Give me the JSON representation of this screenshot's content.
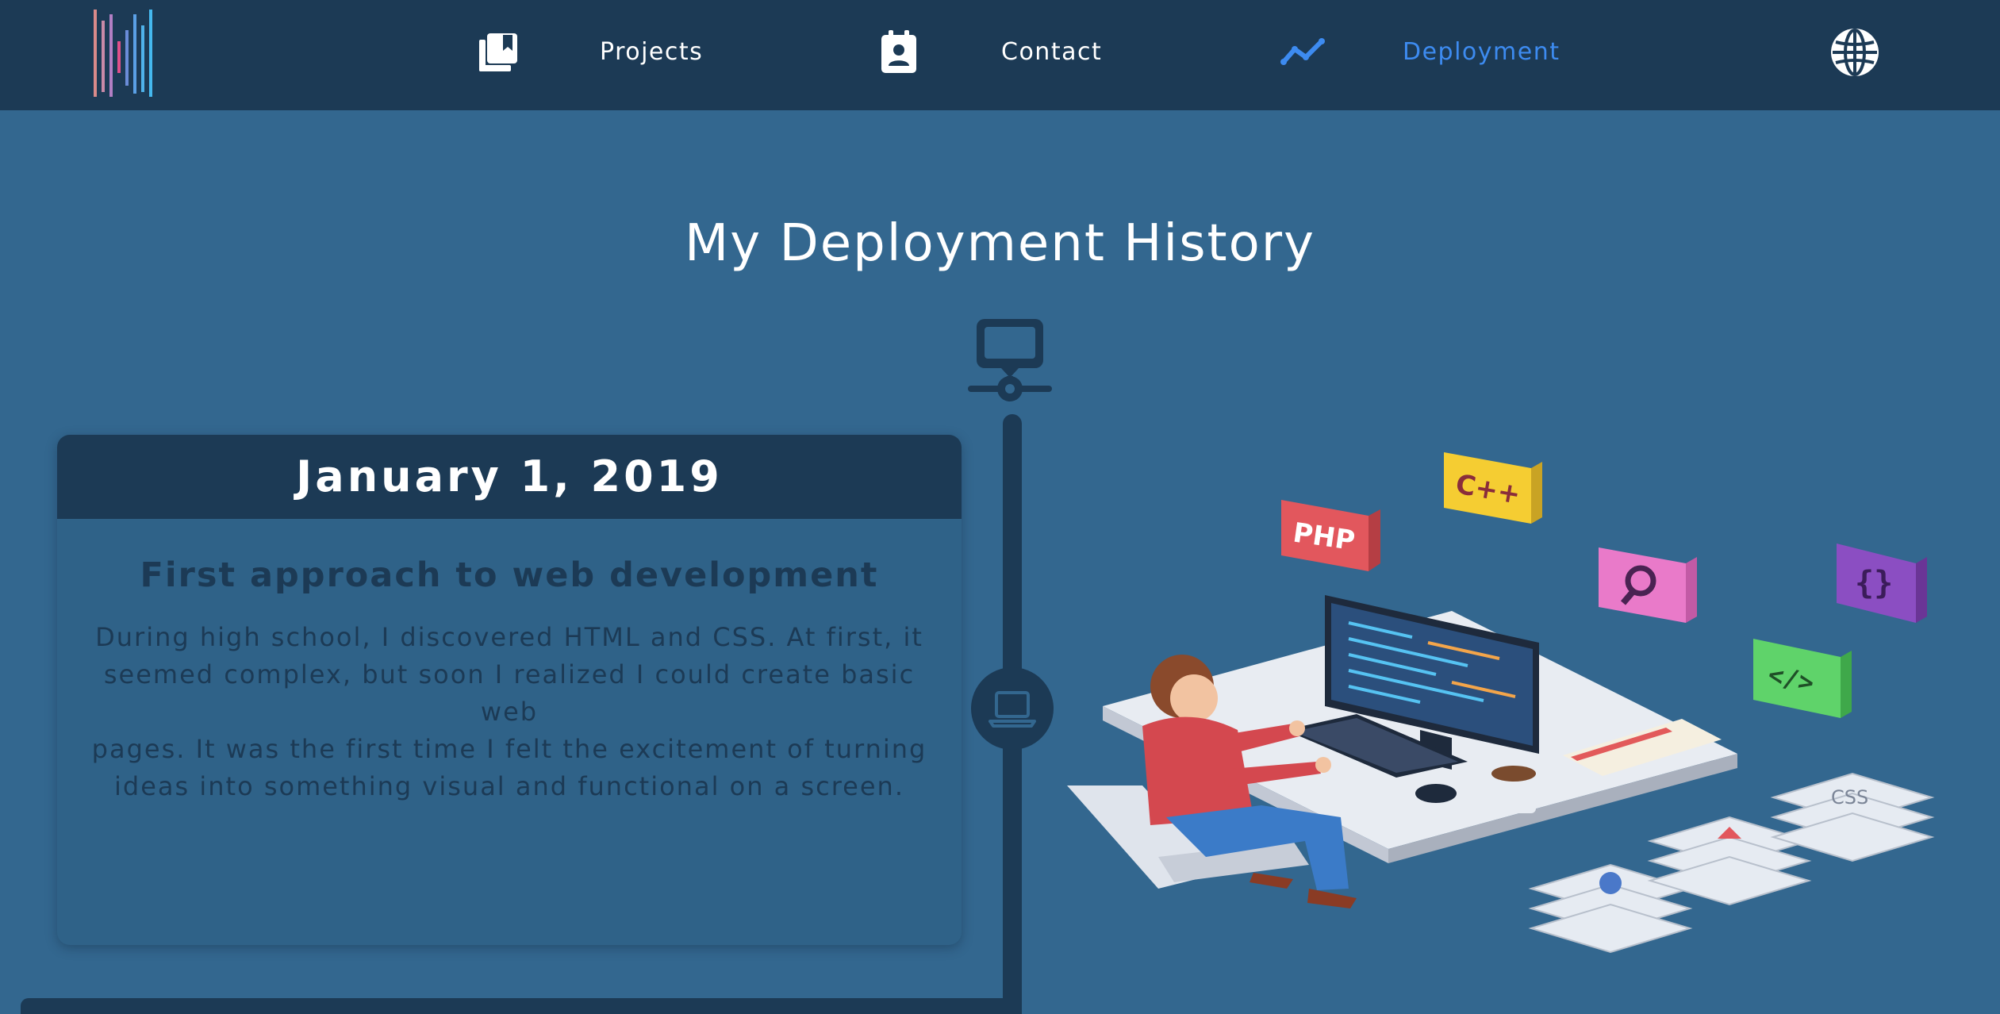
{
  "nav": {
    "items": [
      {
        "label": "Projects",
        "icon": "book-stack-icon",
        "active": false
      },
      {
        "label": "Contact",
        "icon": "contact-badge-icon",
        "active": false
      },
      {
        "label": "Deployment",
        "icon": "trend-line-icon",
        "active": true
      }
    ],
    "language_icon": "globe-icon",
    "logo_icon": "striped-logo-icon",
    "active_color": "#3d8bf0"
  },
  "main": {
    "title": "My Deployment History"
  },
  "timeline": {
    "top_icon": "message-network-icon",
    "node_icon": "laptop-icon",
    "entries": [
      {
        "date": "January 1, 2019",
        "title": "First approach to web development",
        "lines": [
          "During high school, I discovered HTML and CSS. At first, it",
          "seemed complex, but soon I realized I could create basic web",
          "pages. It was the first time I felt the excitement of turning",
          "ideas into something visual and functional on a screen."
        ]
      }
    ]
  },
  "illustration": {
    "badges": [
      "PHP",
      "C++",
      "CSS",
      "</>",
      "{}"
    ],
    "icon": "developer-desk-illustration"
  },
  "colors": {
    "background": "#33678f",
    "navbar": "#1c3a55",
    "card_header": "#1c3a55",
    "card_body": "#2f6288",
    "text_dark": "#1c3a55"
  }
}
